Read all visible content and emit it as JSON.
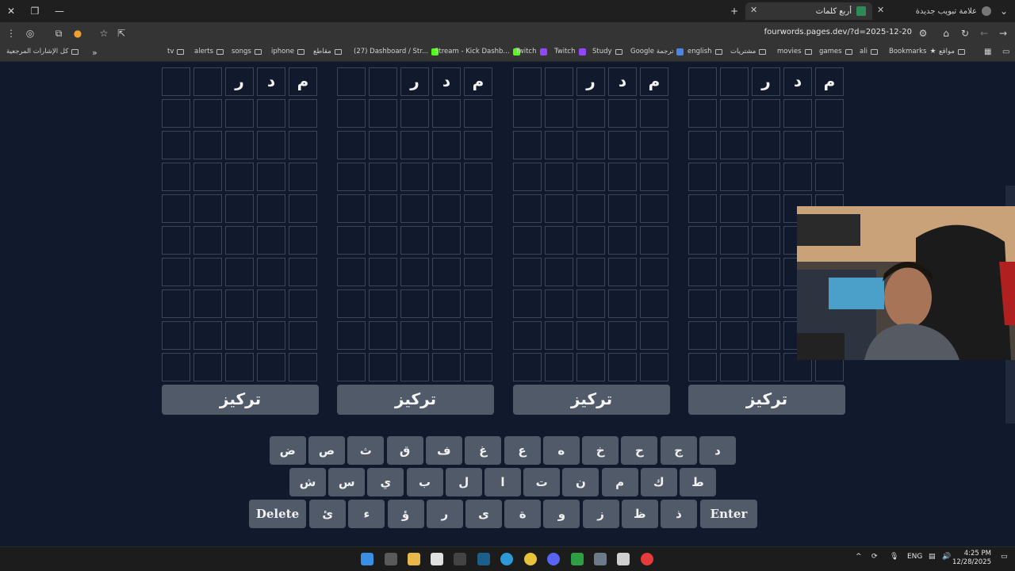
{
  "browser": {
    "tabs": [
      {
        "title": "أربع كلمات",
        "active": true
      },
      {
        "title": "علامة تبويب جديدة",
        "active": false
      }
    ],
    "url": "fourwords.pages.dev/?d=2025-12-20",
    "bookmarks_bar": [
      {
        "label": "كل الإشارات المرجعية"
      },
      {
        "label": "tv"
      },
      {
        "label": "alerts"
      },
      {
        "label": "songs"
      },
      {
        "label": "iphone"
      },
      {
        "label": "مقاطع"
      },
      {
        "label": "(27) Dashboard / Str..."
      },
      {
        "label": "Stream - Kick Dashb..."
      },
      {
        "label": "Twitch"
      },
      {
        "label": "Twitch"
      },
      {
        "label": "Study"
      },
      {
        "label": "Google ترجمة"
      },
      {
        "label": "english"
      },
      {
        "label": "مشتريات"
      },
      {
        "label": "movies"
      },
      {
        "label": "games"
      },
      {
        "label": "ali"
      },
      {
        "label": "Bookmarks"
      },
      {
        "label": "مواقع"
      }
    ]
  },
  "game": {
    "boards": [
      {
        "first_row": [
          "م",
          "د",
          "ر",
          "",
          ""
        ],
        "focus_label": "تركيز"
      },
      {
        "first_row": [
          "م",
          "د",
          "ر",
          "",
          ""
        ],
        "focus_label": "تركيز"
      },
      {
        "first_row": [
          "م",
          "د",
          "ر",
          "",
          ""
        ],
        "focus_label": "تركيز"
      },
      {
        "first_row": [
          "م",
          "د",
          "ر",
          "",
          ""
        ],
        "focus_label": "تركيز"
      }
    ],
    "keyboard": {
      "row1": [
        "د",
        "ج",
        "ح",
        "خ",
        "ه",
        "ع",
        "غ",
        "ف",
        "ق",
        "ث",
        "ص",
        "ض"
      ],
      "row2": [
        "ط",
        "ك",
        "م",
        "ن",
        "ت",
        "ا",
        "ل",
        "ب",
        "ي",
        "س",
        "ش"
      ],
      "row3": [
        "Enter",
        "ذ",
        "ظ",
        "ز",
        "و",
        "ة",
        "ى",
        "ر",
        "ؤ",
        "ء",
        "ئ",
        "Delete"
      ]
    }
  },
  "taskbar": {
    "language": "ENG",
    "time": "4:25 PM",
    "date": "12/28/2025"
  },
  "colors": {
    "background": "#111a2d",
    "key": "#505a69",
    "cell_border": "#3c4658"
  }
}
